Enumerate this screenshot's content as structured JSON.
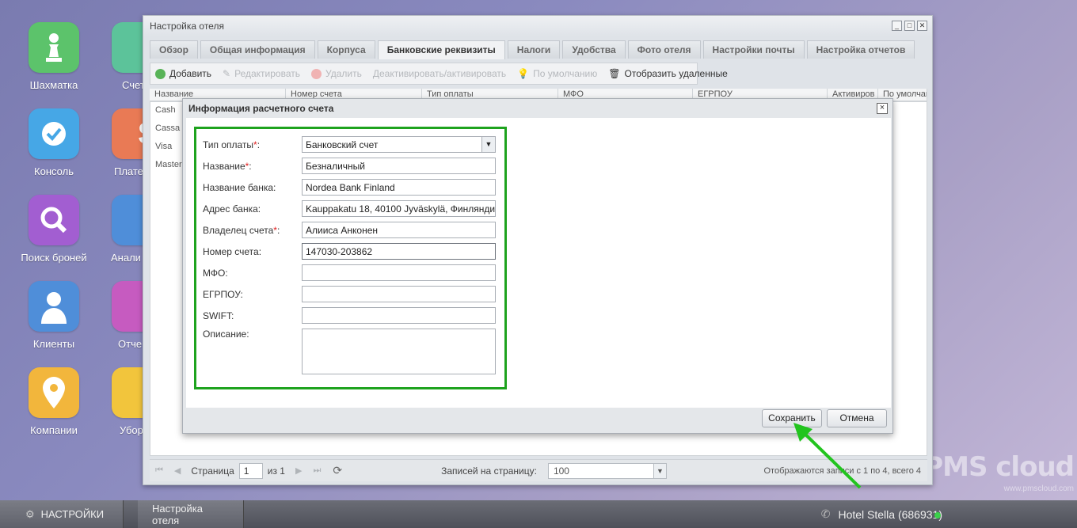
{
  "desktop": {
    "icons": [
      {
        "label": "Шахматка",
        "color": "#5cc36b"
      },
      {
        "label": "Консоль",
        "color": "#46a7e6"
      },
      {
        "label": "Поиск броней",
        "color": "#a25ed1"
      },
      {
        "label": "Клиенты",
        "color": "#4f8ed9"
      },
      {
        "label": "Компании",
        "color": "#f2b63c"
      }
    ],
    "partial_icons": [
      {
        "label": "Счет",
        "color": "#5cc39a"
      },
      {
        "label": "Плате",
        "color": "#e97a55"
      },
      {
        "label": "Анали",
        "color": "#4f8ed9"
      },
      {
        "label": "Отче",
        "color": "#c65bc0"
      },
      {
        "label": "Убор",
        "color": "#f2c53c"
      }
    ],
    "watermark": {
      "brand": "PMS cloud",
      "url": "www.pmscloud.com"
    }
  },
  "window": {
    "title": "Настройка отеля",
    "tabs": [
      "Обзор",
      "Общая информация",
      "Корпуса",
      "Банковские реквизиты",
      "Налоги",
      "Удобства",
      "Фото отеля",
      "Настройки почты",
      "Настройка отчетов"
    ],
    "active_tab": "Банковские реквизиты",
    "toolbar": {
      "add": "Добавить",
      "edit": "Редактировать",
      "delete": "Удалить",
      "toggle": "Деактивировать/активировать",
      "default": "По умолчанию",
      "show_deleted": "Отобразить удаленные"
    },
    "grid": {
      "columns": [
        "Название",
        "Номер счета",
        "Тип оплаты",
        "МФО",
        "ЕГРПОУ",
        "Активиров",
        "По умолчан"
      ],
      "rows": [
        "Cash",
        "Cassa S",
        "Visa",
        "Master"
      ]
    },
    "pager": {
      "page_label": "Страница",
      "page_value": "1",
      "of_label": "из 1",
      "per_page_label": "Записей на страницу:",
      "per_page_value": "100",
      "summary": "Отображаются записи с 1 по 4, всего 4"
    }
  },
  "modal": {
    "title": "Информация расчетного счета",
    "close": "×",
    "fields": {
      "payment_type": {
        "label": "Тип оплаты",
        "value": "Банковский счет"
      },
      "name": {
        "label": "Название",
        "value": "Безналичный"
      },
      "bank_name": {
        "label": "Название банка:",
        "value": "Nordea Bank Finland"
      },
      "bank_address": {
        "label": "Адрес банка:",
        "value": "Kauppakatu 18, 40100 Jyväskylä, Финлянди"
      },
      "owner": {
        "label": "Владелец счета",
        "value": "Алииса Анконен"
      },
      "account_number": {
        "label": "Номер счета:",
        "value": "147030-203862"
      },
      "mfo": {
        "label": "МФО:",
        "value": ""
      },
      "egrpou": {
        "label": "ЕГРПОУ:",
        "value": ""
      },
      "swift": {
        "label": "SWIFT:",
        "value": ""
      },
      "description": {
        "label": "Описание:",
        "value": ""
      }
    },
    "save": "Сохранить",
    "cancel": "Отмена"
  },
  "taskbar": {
    "settings": "НАСТРОЙКИ",
    "open_window": "Настройка отеля",
    "hotel": "Hotel Stella (686931)"
  }
}
